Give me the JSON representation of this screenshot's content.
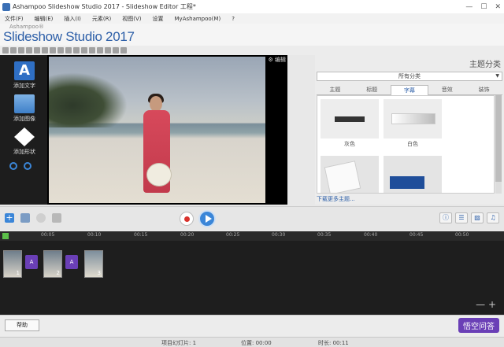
{
  "window": {
    "title": "Ashampoo Slideshow Studio 2017 - Slideshow Editor 工程*"
  },
  "menu": [
    "文件(F)",
    "编辑(E)",
    "插入(I)",
    "元素(R)",
    "视图(V)",
    "设置",
    "MyAshampoo(M)",
    "?"
  ],
  "brand": {
    "small": "Ashampoo®",
    "big": "Slideshow Studio 2017"
  },
  "left_panel": {
    "items": [
      {
        "label": "添加文字"
      },
      {
        "label": "添加图像"
      },
      {
        "label": "添加形状"
      }
    ]
  },
  "preview": {
    "button": "编辑"
  },
  "right_panel": {
    "title": "主题分类",
    "select_value": "所有分类",
    "tabs": [
      "主题",
      "标题",
      "字幕",
      "音效",
      "装饰"
    ],
    "active_tab": 2,
    "thumbs": [
      {
        "label": "灰色"
      },
      {
        "label": "白色"
      },
      {
        "label": ""
      },
      {
        "label": ""
      }
    ],
    "link": "下载更多主题..."
  },
  "ruler": {
    "ticks": [
      "00:05",
      "00:10",
      "00:15",
      "00:20",
      "00:25",
      "00:30",
      "00:35",
      "00:40",
      "00:45",
      "00:50"
    ]
  },
  "timeline": {
    "slides": [
      {
        "num": "1"
      },
      {
        "num": "2"
      },
      {
        "num": "3"
      }
    ],
    "zoom_label": "— +"
  },
  "bottom": {
    "help": "帮助"
  },
  "status": {
    "project_slides": "项目幻灯片: 1",
    "position": "位置: 00:00",
    "duration": "时长: 00:11"
  },
  "watermark": "悟空问答"
}
